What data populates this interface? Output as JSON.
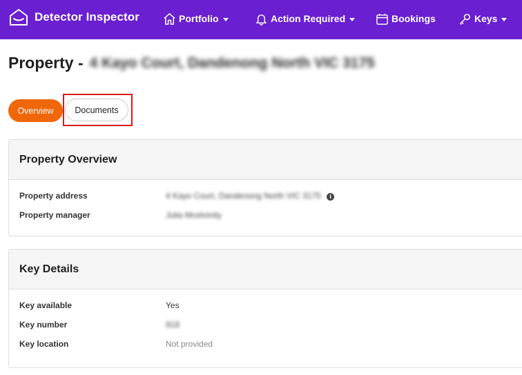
{
  "nav": {
    "brand": "Detector Inspector",
    "items": [
      {
        "label": "Portfolio",
        "icon": "home-icon",
        "dropdown": true
      },
      {
        "label": "Action Required",
        "icon": "bell-icon",
        "dropdown": true
      },
      {
        "label": "Bookings",
        "icon": "calendar-icon",
        "dropdown": false
      },
      {
        "label": "Keys",
        "icon": "key-icon",
        "dropdown": true
      }
    ]
  },
  "page": {
    "title_prefix": "Property -",
    "title_address": "4 Kayo Court, Dandenong North VIC 3175"
  },
  "tabs": {
    "overview": "Overview",
    "documents": "Documents"
  },
  "property_overview": {
    "heading": "Property Overview",
    "rows": [
      {
        "label": "Property address",
        "value": "4 Kayo Court, Dandenong North VIC 3175"
      },
      {
        "label": "Property manager",
        "value": "Julia Mcelvinity"
      }
    ]
  },
  "key_details": {
    "heading": "Key Details",
    "rows": [
      {
        "label": "Key available",
        "value": "Yes"
      },
      {
        "label": "Key number",
        "value": "918"
      },
      {
        "label": "Key location",
        "value": "Not provided"
      }
    ]
  },
  "colors": {
    "nav_bg": "#6a1fd1",
    "accent_orange": "#f0670a",
    "highlight_red": "#d81b1b"
  }
}
